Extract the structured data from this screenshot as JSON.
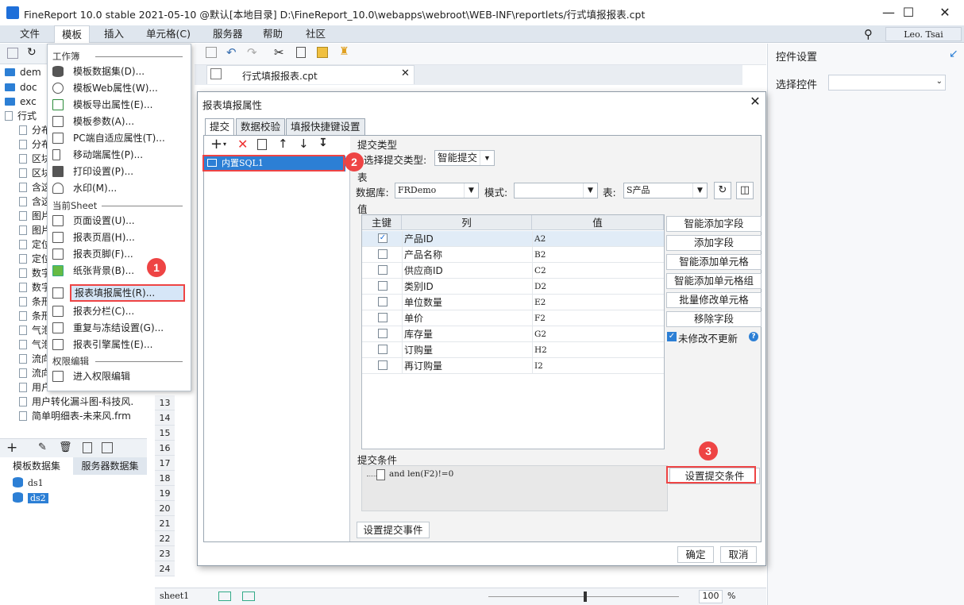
{
  "app": {
    "title": "FineReport 10.0 stable 2021-05-10 @默认[本地目录]    D:\\FineReport_10.0\\webapps\\webroot\\WEB-INF\\reportlets/行式填报报表.cpt",
    "user": "Leo. Tsai"
  },
  "menubar": [
    "文件",
    "模板",
    "插入",
    "单元格(C)",
    "服务器",
    "帮助",
    "社区"
  ],
  "tree": [
    "dem",
    "doc",
    "exc",
    "行式",
    "分布",
    "分布",
    "区块",
    "区块",
    "含这",
    "含这",
    "图片",
    "图片",
    "定位",
    "定位",
    "数字",
    "数字",
    "条形",
    "条形",
    "气泡",
    "气泡",
    "流向",
    "流向",
    "用户",
    "用户转化漏斗图-科技风.",
    "简单明细表-未来风.frm"
  ],
  "datasource_tabs": [
    "模板数据集",
    "服务器数据集"
  ],
  "datasets": [
    "ds1",
    "ds2"
  ],
  "template_menu": {
    "sec_workbook": "工作簿",
    "workbook_items": [
      "模板数据集(D)...",
      "模板Web属性(W)...",
      "模板导出属性(E)...",
      "模板参数(A)...",
      "PC端自适应属性(T)...",
      "移动端属性(P)...",
      "打印设置(P)...",
      "水印(M)..."
    ],
    "sec_sheet": "当前Sheet",
    "sheet_items": [
      "页面设置(U)...",
      "报表页眉(H)...",
      "报表页脚(F)...",
      "纸张背景(B)...",
      "报表填报属性(R)...",
      "报表分栏(C)...",
      "重复与冻结设置(G)...",
      "报表引擎属性(E)..."
    ],
    "sec_perm": "权限编辑",
    "perm_items": [
      "进入权限编辑"
    ]
  },
  "doc_tab": "行式填报报表.cpt",
  "row_numbers": [
    "13",
    "14",
    "15",
    "16",
    "17",
    "18",
    "19",
    "20",
    "21",
    "22",
    "23",
    "24"
  ],
  "statusbar": {
    "sheet": "sheet1",
    "zoom": "100",
    "pct": "%"
  },
  "right_panel": {
    "title": "控件设置",
    "label": "选择控件"
  },
  "dialog": {
    "title": "报表填报属性",
    "tabs": [
      "提交",
      "数据校验",
      "填报快捷键设置"
    ],
    "sql_item": "内置SQL1",
    "submit_type_section": "提交类型",
    "submit_type_label": "选择提交类型:",
    "submit_type_value": "智能提交",
    "table_section": "表",
    "db_label": "数据库:",
    "db_value": "FRDemo",
    "schema_label": "模式:",
    "schema_value": "",
    "table_label": "表:",
    "table_value": "S产品",
    "value_section": "值",
    "columns": [
      "主键",
      "列",
      "值"
    ],
    "rows": [
      {
        "key": true,
        "col": "产品ID",
        "val": "A2"
      },
      {
        "key": false,
        "col": "产品名称",
        "val": "B2"
      },
      {
        "key": false,
        "col": "供应商ID",
        "val": "C2"
      },
      {
        "key": false,
        "col": "类别ID",
        "val": "D2"
      },
      {
        "key": false,
        "col": "单位数量",
        "val": "E2"
      },
      {
        "key": false,
        "col": "单价",
        "val": "F2"
      },
      {
        "key": false,
        "col": "库存量",
        "val": "G2"
      },
      {
        "key": false,
        "col": "订购量",
        "val": "H2"
      },
      {
        "key": false,
        "col": "再订购量",
        "val": "I2"
      }
    ],
    "side_buttons": [
      "智能添加字段",
      "添加字段",
      "智能添加单元格",
      "智能添加单元格组",
      "批量修改单元格",
      "移除字段"
    ],
    "no_update_label": "未修改不更新",
    "condition_section": "提交条件",
    "condition_text": "and len(F2)!=0",
    "set_condition_button": "设置提交条件",
    "set_event_button": "设置提交事件",
    "ok": "确定",
    "cancel": "取消"
  },
  "annotations": [
    "1",
    "2",
    "3"
  ],
  "colors": {
    "accent": "#2c7fd5",
    "highlight_red": "#e44444",
    "menubar": "#dfe6ee"
  }
}
